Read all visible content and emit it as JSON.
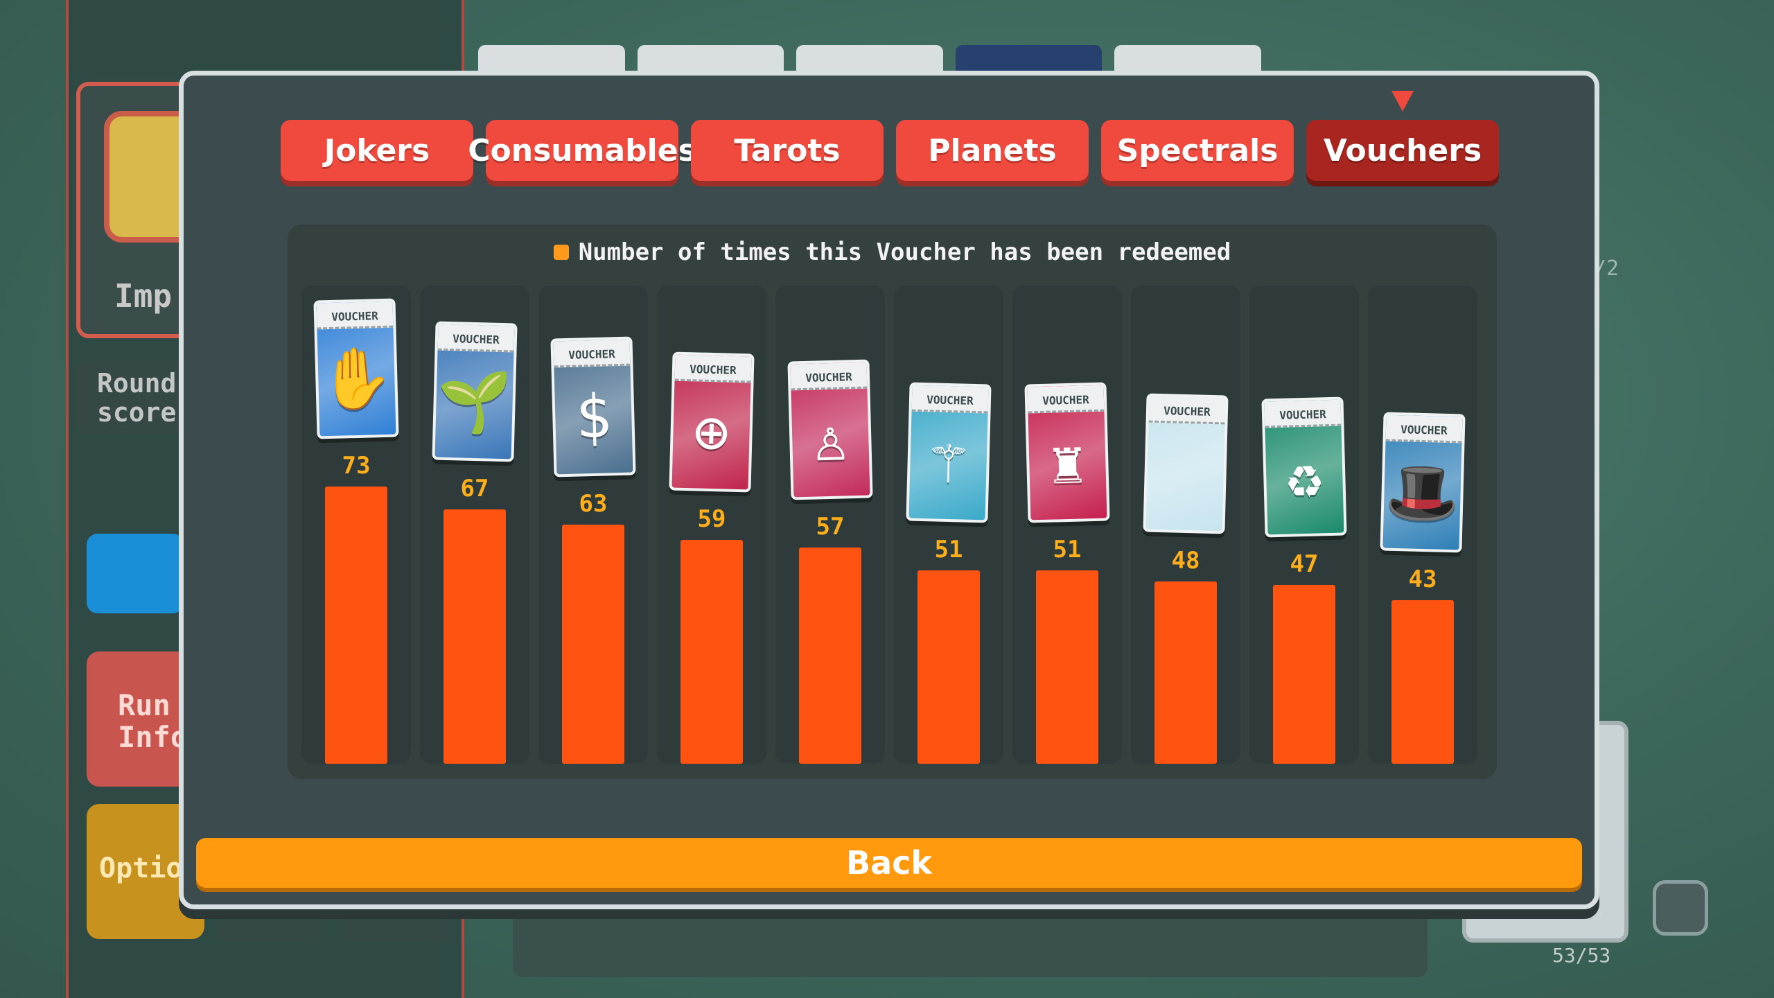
{
  "background": {
    "blind_label": "Imp",
    "round_score_label": "Round score",
    "run_info_label": "Run Info",
    "options_label": "Option",
    "right_fraction": "/2",
    "deck_count": "53/53"
  },
  "tabs": [
    {
      "label": "Jokers",
      "active": false
    },
    {
      "label": "Consumables",
      "active": false
    },
    {
      "label": "Tarots",
      "active": false
    },
    {
      "label": "Planets",
      "active": false
    },
    {
      "label": "Spectrals",
      "active": false
    },
    {
      "label": "Vouchers",
      "active": true
    }
  ],
  "back_label": "Back",
  "voucher_stub_label": "VOUCHER",
  "vouchers": [
    {
      "icon": "hand-icon",
      "glyph": "✋",
      "color": "#2f7fd6"
    },
    {
      "icon": "seed-money-icon",
      "glyph": "🌱",
      "color": "#3a76b8"
    },
    {
      "icon": "money-icon",
      "glyph": "$",
      "color": "#4a6f8f"
    },
    {
      "icon": "plus-slot-icon",
      "glyph": "⊕",
      "color": "#c0244b"
    },
    {
      "icon": "figure-icon",
      "glyph": "♙",
      "color": "#c32a5c"
    },
    {
      "icon": "wand-icon",
      "glyph": "⚚",
      "color": "#3aa9c9"
    },
    {
      "icon": "bucket-icon",
      "glyph": "♜",
      "color": "#c51f4e"
    },
    {
      "icon": "blank-icon",
      "glyph": "",
      "color": "#c7e4ee"
    },
    {
      "icon": "recycle-icon",
      "glyph": "♻",
      "color": "#1a8a6b"
    },
    {
      "icon": "magic-hat-icon",
      "glyph": "🎩",
      "color": "#2e7fb7"
    }
  ],
  "chart_data": {
    "type": "bar",
    "legend": [
      "Number of times this Voucher has been redeemed"
    ],
    "series": [
      {
        "name": "Number of times this Voucher has been redeemed",
        "values": [
          73,
          67,
          63,
          59,
          57,
          51,
          51,
          48,
          47,
          43
        ]
      }
    ],
    "ylim": [
      0,
      73
    ],
    "grid": false,
    "legend_placement": "top-center",
    "bar_color": "#ff5411",
    "label_color": "#ffae1c"
  }
}
